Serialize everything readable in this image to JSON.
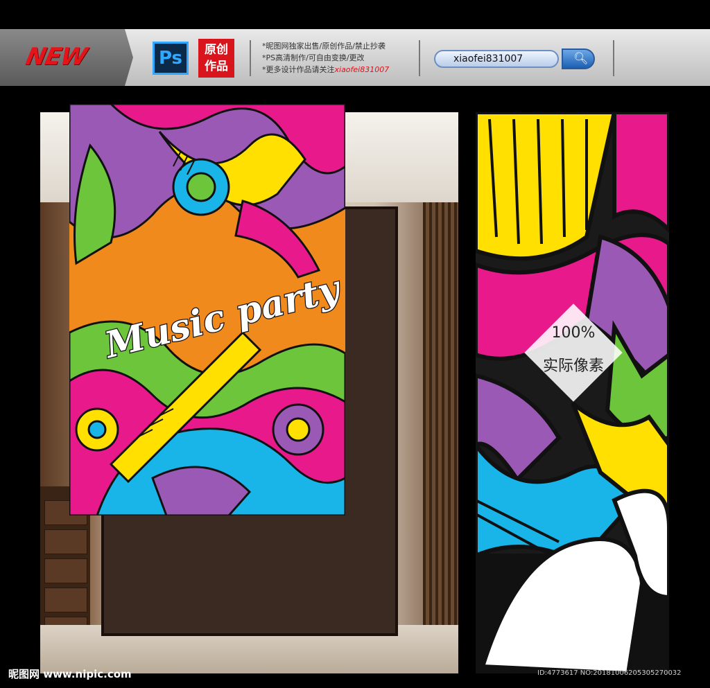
{
  "banner": {
    "new_label": "NEW",
    "ps_label": "Ps",
    "original_badge": "原创作品",
    "notes": {
      "line1": "*昵图网独家出售/原创作品/禁止抄袭",
      "line2": "*PS高清制作/可自由变换/更改",
      "line3_prefix": "*更多设计作品请关注",
      "line3_user": "xiaofei831007"
    },
    "search_value": "xiaofei831007"
  },
  "poster": {
    "title": "Music party"
  },
  "badge": {
    "line1": "100%",
    "line2": "实际像素"
  },
  "footer": {
    "left": "昵图网 www.nipic.com",
    "right": "ID:4773617 NO:20181006205305270032"
  },
  "colors": {
    "orange": "#f08a1c",
    "magenta": "#e8198b",
    "yellow": "#ffe000",
    "cyan": "#19b4e8",
    "green": "#6cc53b",
    "purple": "#9b59b6"
  }
}
